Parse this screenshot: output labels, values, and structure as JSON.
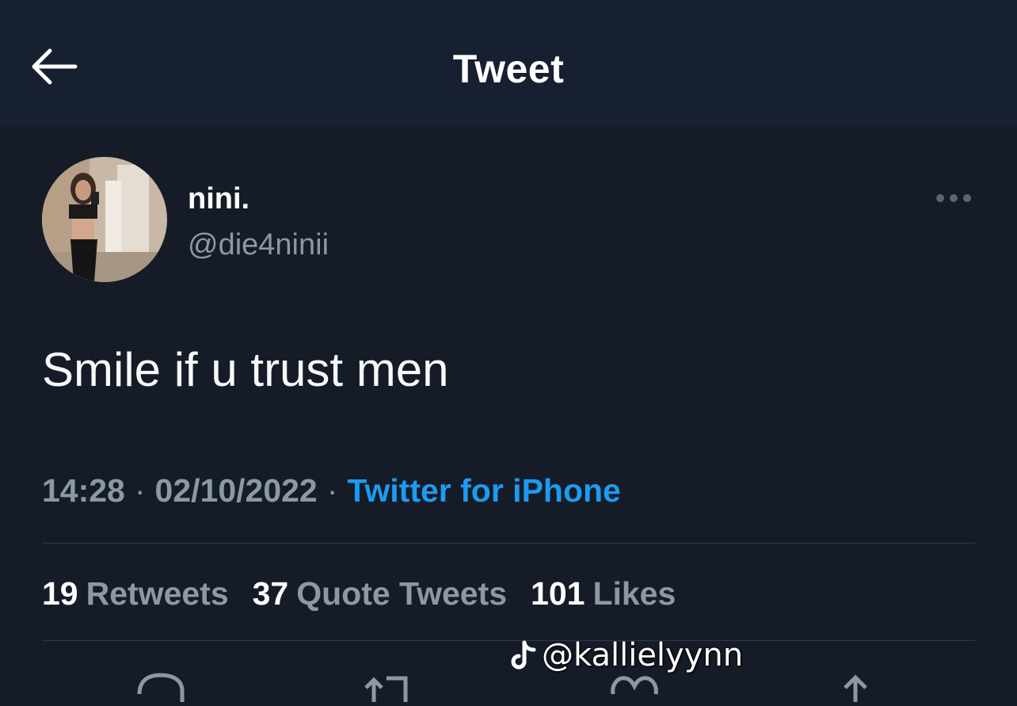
{
  "header": {
    "title": "Tweet",
    "back_icon": "arrow-left-icon"
  },
  "tweet": {
    "author": {
      "display_name": "nini.",
      "handle": "@die4ninii"
    },
    "more_icon": "more-horizontal-icon",
    "text": "Smile if u trust men",
    "time": "14:28",
    "date": "02/10/2022",
    "separator": "·",
    "source": "Twitter for iPhone",
    "stats": {
      "retweets_count": "19",
      "retweets_label": "Retweets",
      "quotes_count": "37",
      "quotes_label": "Quote Tweets",
      "likes_count": "101",
      "likes_label": "Likes"
    },
    "actions": [
      "reply-icon",
      "retweet-icon",
      "like-icon",
      "share-icon"
    ]
  },
  "watermark": {
    "icon": "tiktok-icon",
    "text": "@kallielyynn"
  },
  "colors": {
    "background": "#151c28",
    "header_background": "#172030",
    "text_primary": "#ffffff",
    "text_secondary": "#8b98a5",
    "accent": "#1d9bf0"
  }
}
